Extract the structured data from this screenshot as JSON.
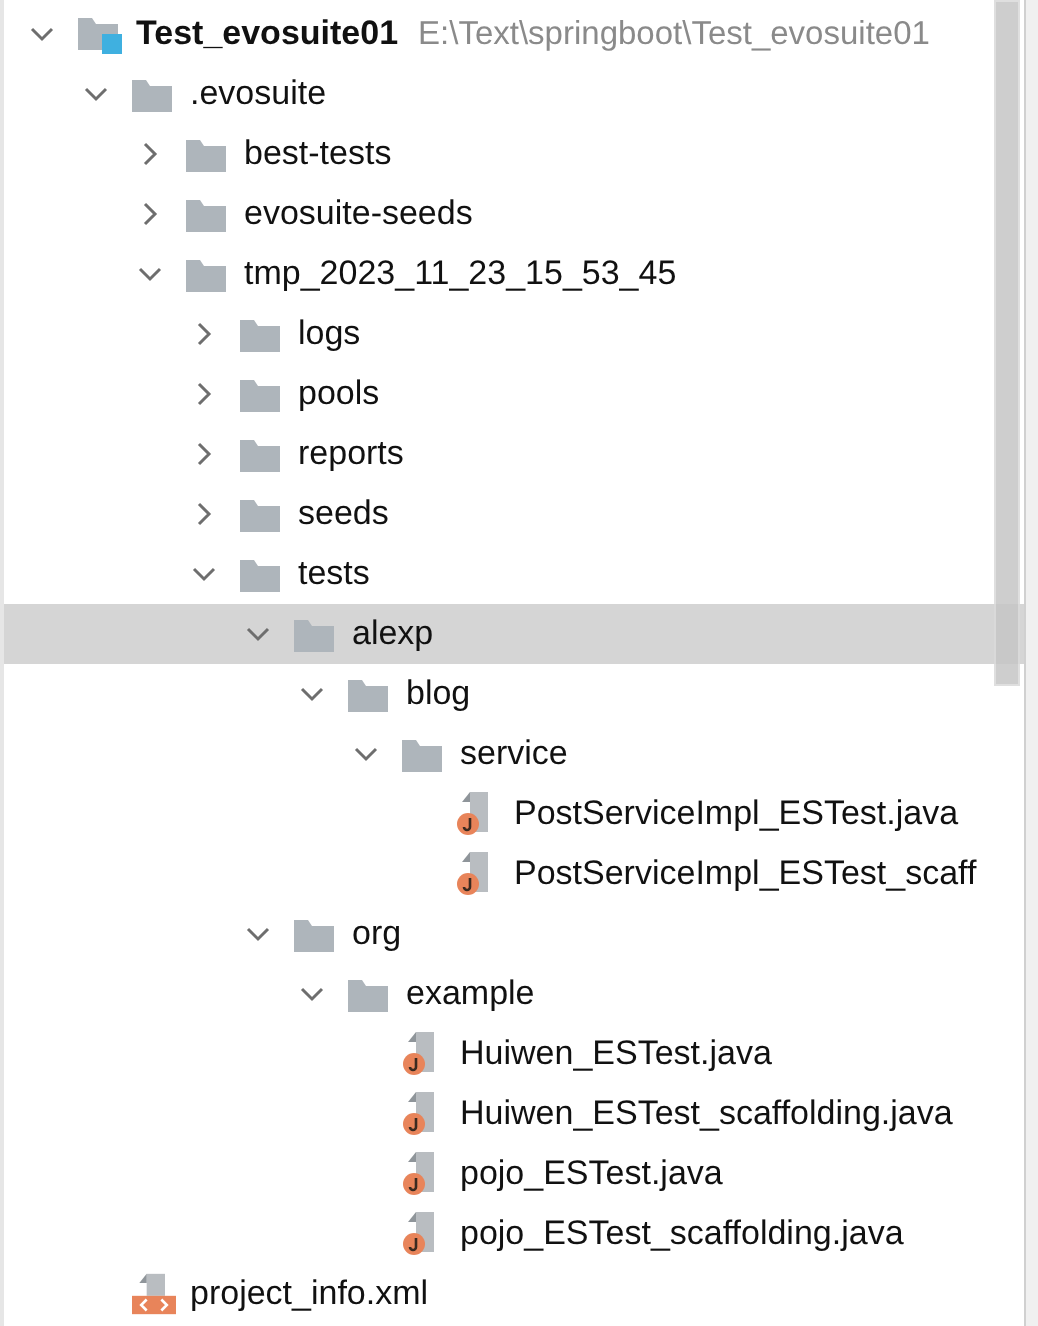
{
  "tree": [
    {
      "kind": "module",
      "label": "Test_evosuite01",
      "path": "E:\\Text\\springboot\\Test_evosuite01",
      "expanded": true,
      "selected": false,
      "children": [
        {
          "kind": "folder",
          "label": ".evosuite",
          "expanded": true,
          "selected": false,
          "children": [
            {
              "kind": "folder",
              "label": "best-tests",
              "expanded": false,
              "selected": false
            },
            {
              "kind": "folder",
              "label": "evosuite-seeds",
              "expanded": false,
              "selected": false
            },
            {
              "kind": "folder",
              "label": "tmp_2023_11_23_15_53_45",
              "expanded": true,
              "selected": false,
              "children": [
                {
                  "kind": "folder",
                  "label": "logs",
                  "expanded": false,
                  "selected": false
                },
                {
                  "kind": "folder",
                  "label": "pools",
                  "expanded": false,
                  "selected": false
                },
                {
                  "kind": "folder",
                  "label": "reports",
                  "expanded": false,
                  "selected": false
                },
                {
                  "kind": "folder",
                  "label": "seeds",
                  "expanded": false,
                  "selected": false
                },
                {
                  "kind": "folder",
                  "label": "tests",
                  "expanded": true,
                  "selected": false,
                  "children": [
                    {
                      "kind": "folder",
                      "label": "alexp",
                      "expanded": true,
                      "selected": true,
                      "children": [
                        {
                          "kind": "folder",
                          "label": "blog",
                          "expanded": true,
                          "selected": false,
                          "children": [
                            {
                              "kind": "folder",
                              "label": "service",
                              "expanded": true,
                              "selected": false,
                              "children": [
                                {
                                  "kind": "java",
                                  "label": "PostServiceImpl_ESTest.java",
                                  "selected": false
                                },
                                {
                                  "kind": "java",
                                  "label": "PostServiceImpl_ESTest_scaff",
                                  "selected": false
                                }
                              ]
                            }
                          ]
                        }
                      ]
                    },
                    {
                      "kind": "folder",
                      "label": "org",
                      "expanded": true,
                      "selected": false,
                      "children": [
                        {
                          "kind": "folder",
                          "label": "example",
                          "expanded": true,
                          "selected": false,
                          "children": [
                            {
                              "kind": "java",
                              "label": "Huiwen_ESTest.java",
                              "selected": false
                            },
                            {
                              "kind": "java",
                              "label": "Huiwen_ESTest_scaffolding.java",
                              "selected": false
                            },
                            {
                              "kind": "java",
                              "label": "pojo_ESTest.java",
                              "selected": false
                            },
                            {
                              "kind": "java",
                              "label": "pojo_ESTest_scaffolding.java",
                              "selected": false
                            }
                          ]
                        }
                      ]
                    }
                  ]
                }
              ]
            }
          ]
        },
        {
          "kind": "xml",
          "label": "project_info.xml",
          "selected": false
        }
      ]
    }
  ]
}
